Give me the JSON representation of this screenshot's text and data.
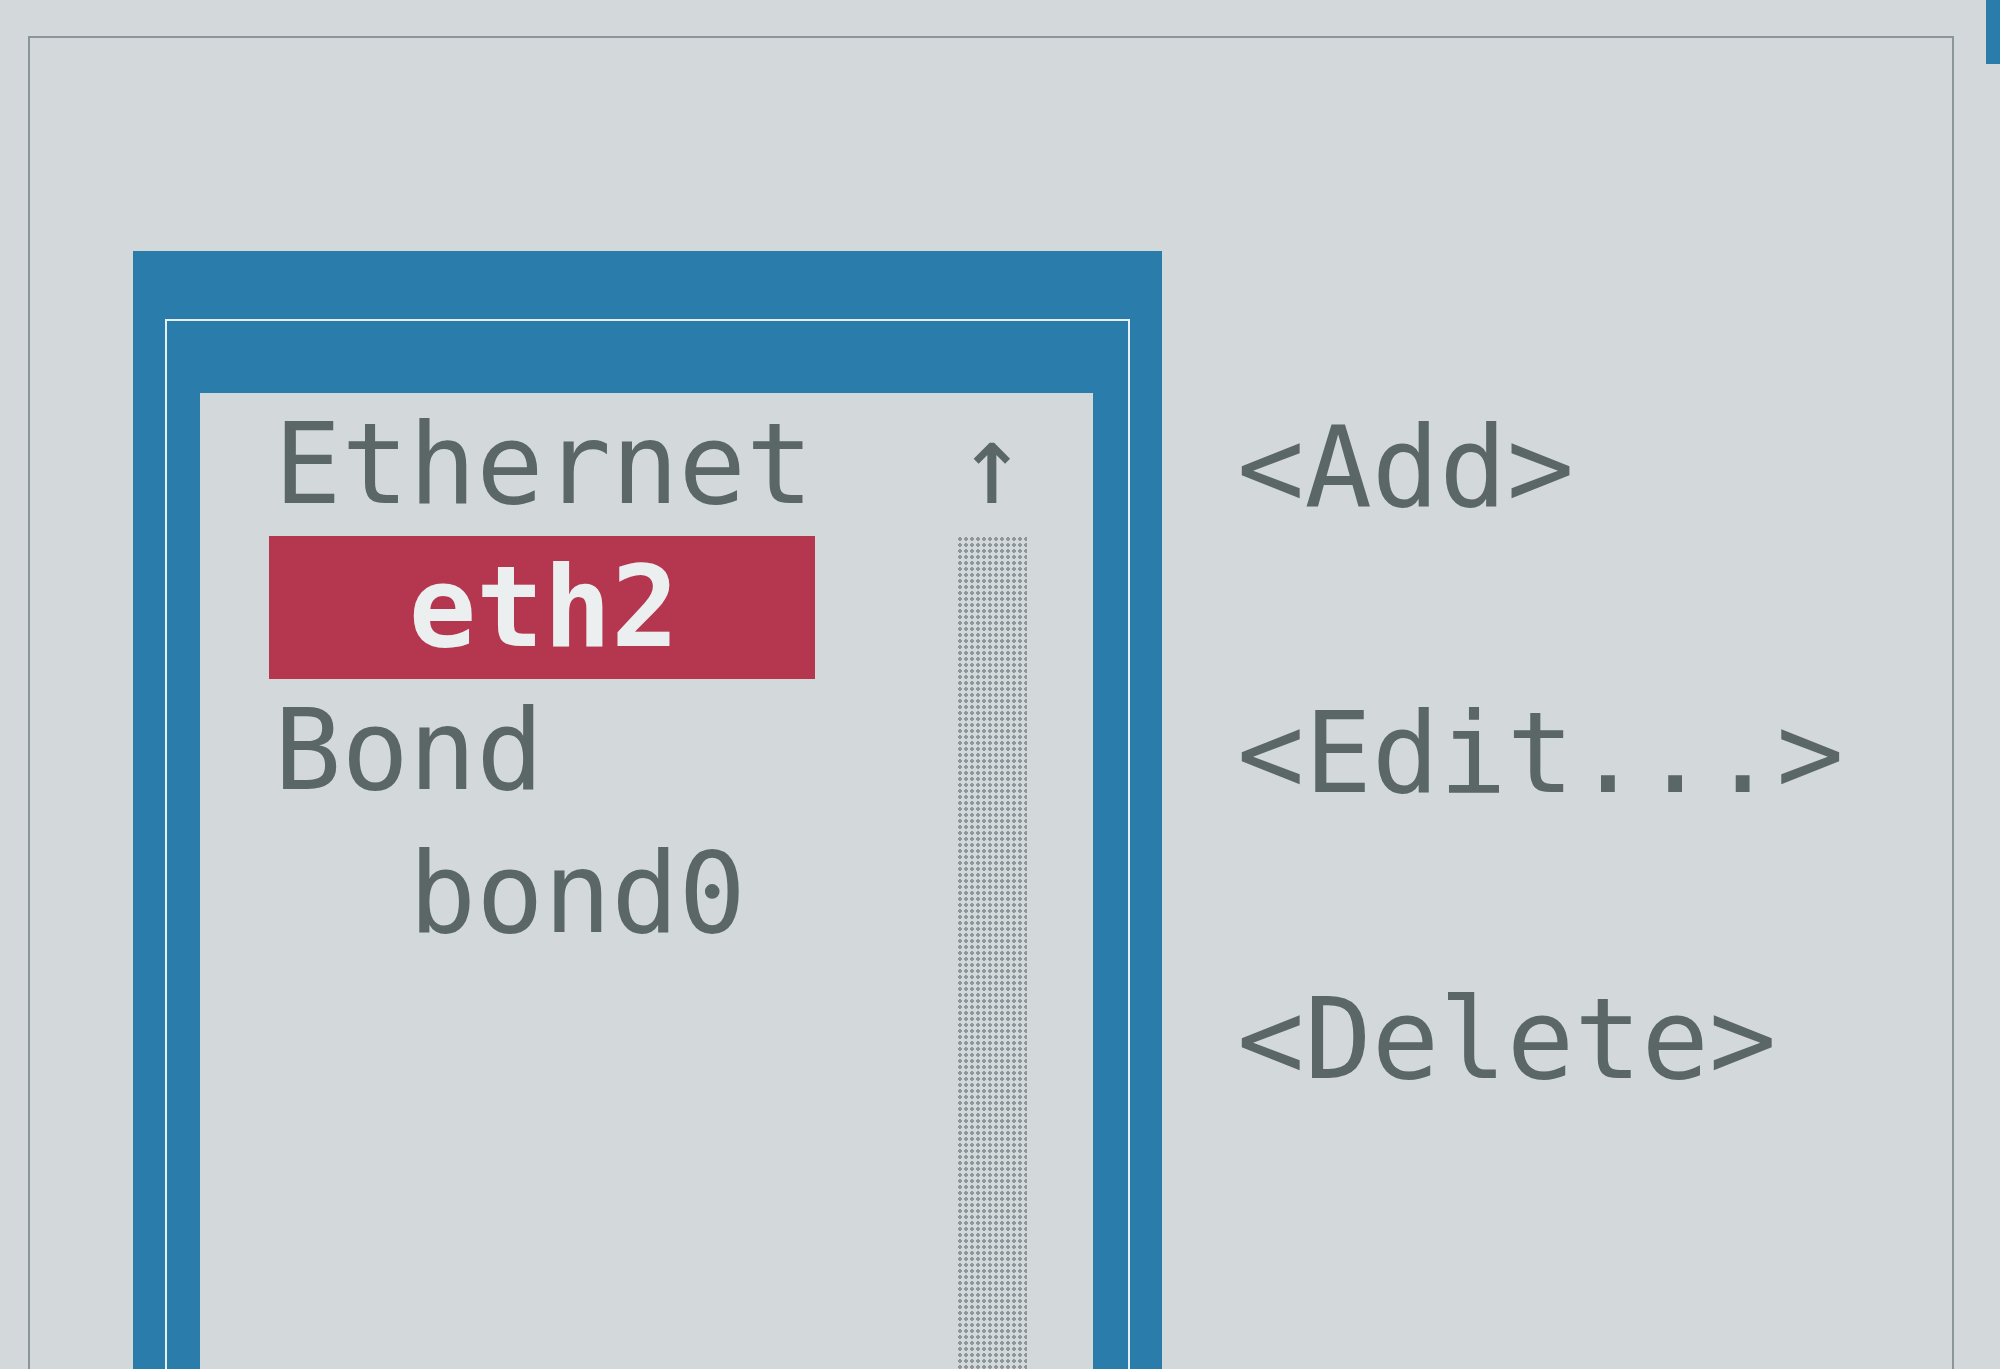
{
  "list": {
    "scroll_up": "↑",
    "groups": [
      {
        "label": "Ethernet",
        "children": [
          {
            "label": "eth2",
            "selected": true
          }
        ]
      },
      {
        "label": "Bond",
        "children": [
          {
            "label": "bond0",
            "selected": false
          }
        ]
      }
    ]
  },
  "buttons": [
    "<Add>",
    "<Edit...>",
    "<Delete>"
  ]
}
